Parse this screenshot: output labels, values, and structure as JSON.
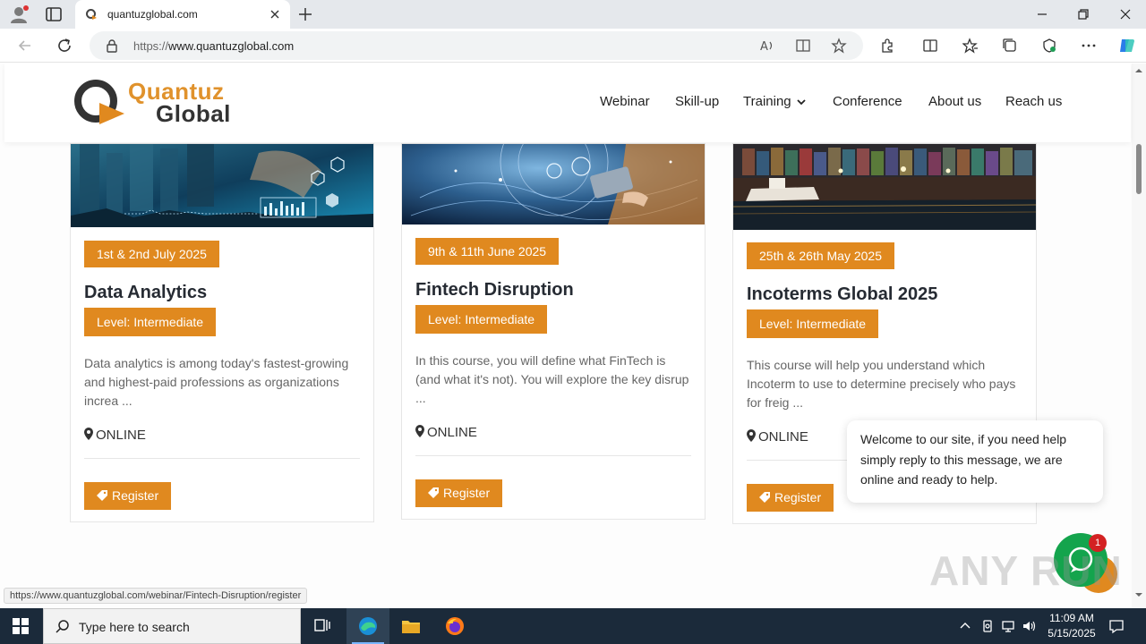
{
  "browser": {
    "tab_title": "quantuzglobal.com",
    "url_protocol": "https://",
    "url_host": "www.quantuzglobal.com",
    "status_url": "https://www.quantuzglobal.com/webinar/Fintech-Disruption/register"
  },
  "site": {
    "logo_word1": "Quantuz",
    "logo_word2": "Global",
    "nav": [
      {
        "label": "Webinar"
      },
      {
        "label": "Skill-up"
      },
      {
        "label": "Training"
      },
      {
        "label": "Conference"
      },
      {
        "label": "About us"
      },
      {
        "label": "Reach us"
      }
    ],
    "brand_color": "#e0891f"
  },
  "courses": [
    {
      "date": "1st & 2nd July 2025",
      "title": "Data Analytics",
      "level": "Level: Intermediate",
      "desc": "Data analytics is among today's fastest-growing and highest-paid professions as organizations increa ...",
      "location": "ONLINE",
      "register": "Register"
    },
    {
      "date": "9th & 11th June 2025",
      "title": "Fintech Disruption",
      "level": "Level: Intermediate",
      "desc": "In this course, you will define what FinTech is (and what it's not). You will explore the key disrup ...",
      "location": "ONLINE",
      "register": "Register"
    },
    {
      "date": "25th & 26th May 2025",
      "title": "Incoterms Global 2025",
      "level": "Level: Intermediate",
      "desc": "This course will help you understand which Incoterm to use to determine precisely who pays for freig ...",
      "location": "ONLINE",
      "register": "Register"
    }
  ],
  "chat": {
    "message": "Welcome to our site, if you need help simply reply to this message, we are online and ready to help.",
    "badge": "1"
  },
  "watermark": "ANY RUN",
  "taskbar": {
    "search_placeholder": "Type here to search",
    "time": "11:09 AM",
    "date": "5/15/2025"
  }
}
